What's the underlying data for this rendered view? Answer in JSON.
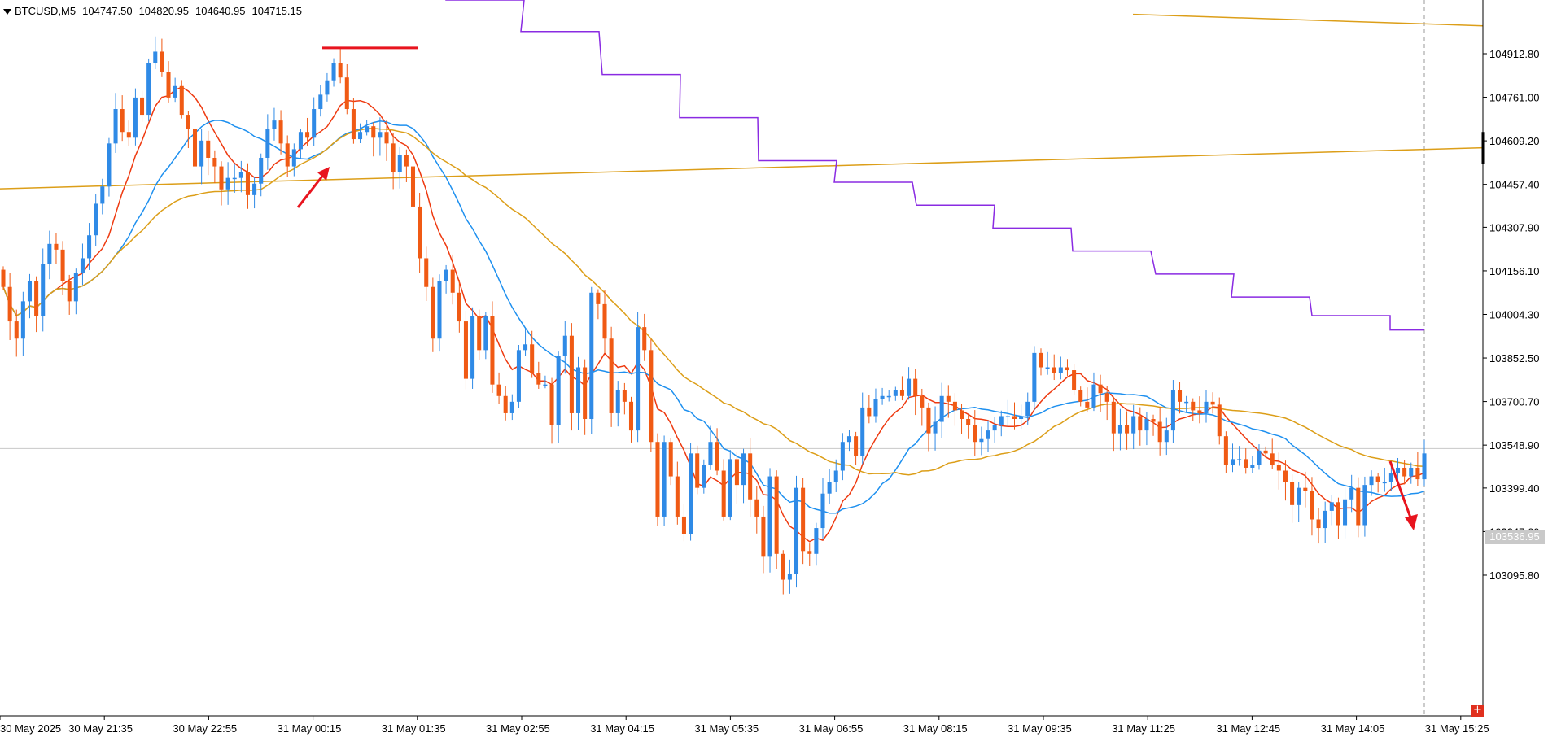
{
  "header": {
    "symbol": "BTCUSD,M5",
    "open": "104747.50",
    "high": "104820.95",
    "low": "104640.95",
    "close": "104715.15"
  },
  "current_price": "103536.95",
  "chart_data": {
    "type": "candlestick",
    "title": "BTCUSD,M5",
    "ylim": [
      103020,
      105050
    ],
    "y_ticks": [
      "104912.80",
      "104761.00",
      "104609.20",
      "104457.40",
      "104307.90",
      "104156.10",
      "104004.30",
      "103852.50",
      "103700.70",
      "103548.90",
      "103399.40",
      "103247.60",
      "103095.80"
    ],
    "x_ticks": [
      "30 May 2025",
      "30 May 21:35",
      "30 May 22:55",
      "31 May 00:15",
      "31 May 01:35",
      "31 May 02:55",
      "31 May 04:15",
      "31 May 05:35",
      "31 May 06:55",
      "31 May 08:15",
      "31 May 09:35",
      "31 May 11:25",
      "31 May 12:45",
      "31 May 14:05",
      "31 May 15:25"
    ],
    "candle_closes": [
      104100,
      103980,
      103920,
      104050,
      104120,
      104000,
      104180,
      104250,
      104230,
      104120,
      104050,
      104150,
      104200,
      104280,
      104390,
      104450,
      104600,
      104720,
      104640,
      104620,
      104760,
      104700,
      104880,
      104920,
      104850,
      104760,
      104800,
      104700,
      104650,
      104520,
      104610,
      104550,
      104520,
      104440,
      104480,
      104480,
      104500,
      104420,
      104460,
      104550,
      104650,
      104680,
      104600,
      104520,
      104580,
      104640,
      104620,
      104720,
      104770,
      104820,
      104880,
      104830,
      104720,
      104615,
      104640,
      104660,
      104620,
      104640,
      104600,
      104500,
      104560,
      104520,
      104380,
      104200,
      104100,
      103920,
      104120,
      104160,
      104080,
      103980,
      103780,
      104000,
      103880,
      104000,
      103760,
      103720,
      103660,
      103700,
      103880,
      103900,
      103800,
      103760,
      103760,
      103620,
      103860,
      103930,
      103660,
      103820,
      103640,
      104080,
      104040,
      103920,
      103660,
      103740,
      103700,
      103600,
      103960,
      103880,
      103560,
      103300,
      103560,
      103440,
      103300,
      103240,
      103520,
      103400,
      103480,
      103560,
      103460,
      103300,
      103500,
      103410,
      103520,
      103360,
      103300,
      103160,
      103440,
      103170,
      103080,
      103100,
      103400,
      103180,
      103170,
      103260,
      103380,
      103420,
      103460,
      103560,
      103580,
      103510,
      103680,
      103650,
      103710,
      103720,
      103720,
      103740,
      103720,
      103780,
      103720,
      103680,
      103590,
      103630,
      103720,
      103700,
      103670,
      103640,
      103620,
      103560,
      103570,
      103600,
      103620,
      103650,
      103650,
      103640,
      103650,
      103700,
      103870,
      103820,
      103820,
      103800,
      103820,
      103810,
      103740,
      103700,
      103680,
      103760,
      103730,
      103700,
      103590,
      103620,
      103590,
      103650,
      103600,
      103640,
      103630,
      103560,
      103600,
      103740,
      103700,
      103700,
      103670,
      103660,
      103700,
      103690,
      103580,
      103480,
      103500,
      103500,
      103470,
      103480,
      103530,
      103520,
      103480,
      103460,
      103420,
      103340,
      103400,
      103390,
      103290,
      103260,
      103320,
      103350,
      103270,
      103360,
      103400,
      103270,
      103410,
      103440,
      103420,
      103420,
      103450,
      103470,
      103440,
      103470,
      103430,
      103520
    ],
    "indicators": [
      {
        "name": "MA fast",
        "color": "#ee3a10"
      },
      {
        "name": "MA mid",
        "color": "#1e90ef"
      },
      {
        "name": "MA slow",
        "color": "#dc9e18"
      },
      {
        "name": "trend line",
        "color": "#dc9e18"
      },
      {
        "name": "stepped level",
        "color": "#8a2be2"
      }
    ],
    "colors": {
      "bull": "#2f8ae6",
      "bear": "#f05a14",
      "annotation": "#e8141e",
      "grid": "#c8c8c8"
    },
    "annotations": [
      "resistance-mark",
      "entry-arrow",
      "exit-arrow"
    ],
    "grid": false
  }
}
